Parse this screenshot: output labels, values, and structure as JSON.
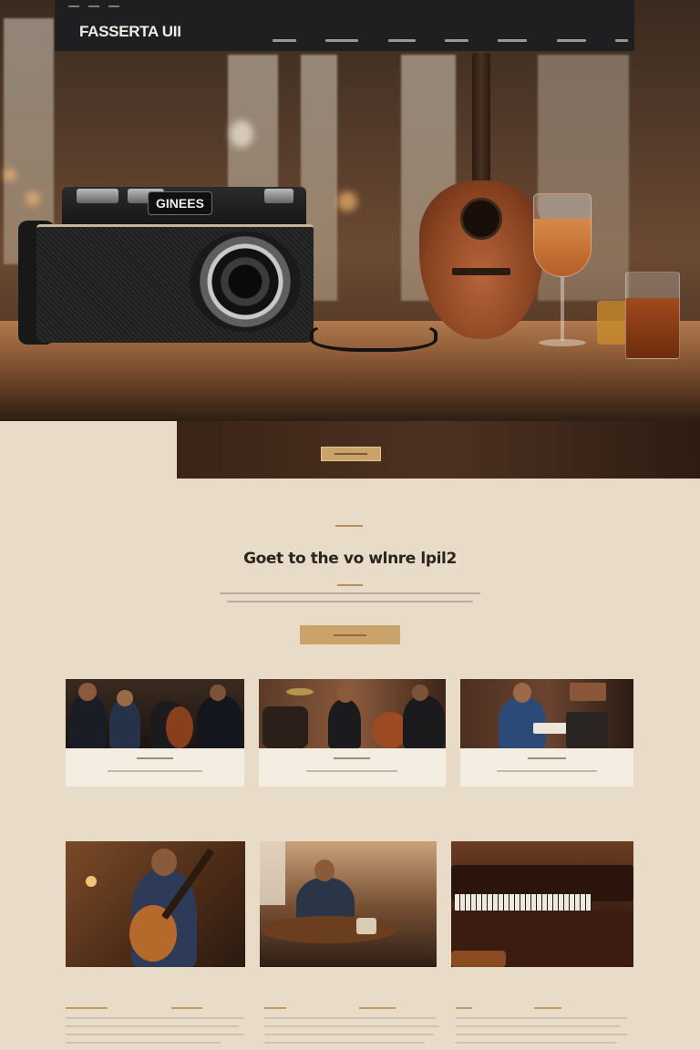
{
  "site": {
    "logo": "FASSERTA UII"
  },
  "navigation": {
    "items": [
      "",
      "",
      "",
      "",
      "",
      "",
      ""
    ]
  },
  "hero": {
    "camera_brand": "GINEES",
    "camera_sub": "",
    "banner_button_label": ""
  },
  "intro": {
    "headline": "Goet to the vo wlnre lpil2",
    "body": "",
    "cta_label": ""
  },
  "cards": [
    {
      "title": "",
      "caption": ""
    },
    {
      "title": "",
      "caption": ""
    },
    {
      "title": "",
      "caption": ""
    }
  ],
  "gallery": [
    {
      "subject": "guitarist"
    },
    {
      "subject": "man-at-table"
    },
    {
      "subject": "piano"
    }
  ],
  "footer_blocks": [
    {
      "label": "",
      "date": ""
    },
    {
      "label": "",
      "date": ""
    },
    {
      "label": "",
      "date": ""
    }
  ],
  "colors": {
    "page_background": "#e8dcc8",
    "navbar": "#1c1e22",
    "accent": "#c9a36a",
    "card_caption_bg": "#f4ede2",
    "headline_text": "#2a2420"
  }
}
